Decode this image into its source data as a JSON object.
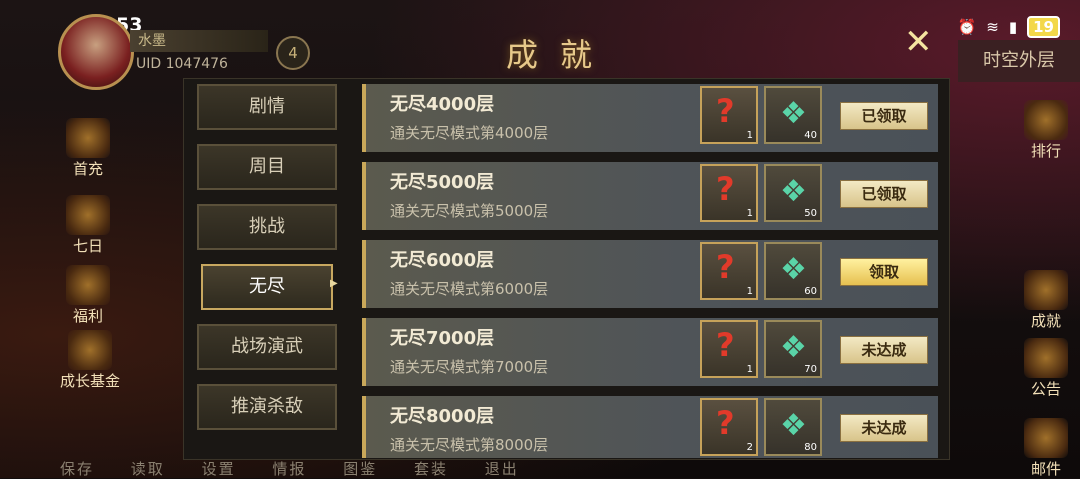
{
  "status_bar": {
    "time": "21:53",
    "battery": "19"
  },
  "player": {
    "name": "水墨",
    "uid": "UID 1047476",
    "level": "4"
  },
  "window": {
    "title": "成就",
    "right_label": "时空外层"
  },
  "tabs": [
    {
      "label": "剧情"
    },
    {
      "label": "周目"
    },
    {
      "label": "挑战"
    },
    {
      "label": "无尽"
    },
    {
      "label": "战场演武"
    },
    {
      "label": "推演杀敌"
    }
  ],
  "achievements": [
    {
      "title": "无尽4000层",
      "desc": "通关无尽模式第4000层",
      "chest_count": "1",
      "gem_count": "40",
      "status": "已领取"
    },
    {
      "title": "无尽5000层",
      "desc": "通关无尽模式第5000层",
      "chest_count": "1",
      "gem_count": "50",
      "status": "已领取"
    },
    {
      "title": "无尽6000层",
      "desc": "通关无尽模式第6000层",
      "chest_count": "1",
      "gem_count": "60",
      "status": "领取"
    },
    {
      "title": "无尽7000层",
      "desc": "通关无尽模式第7000层",
      "chest_count": "1",
      "gem_count": "70",
      "status": "未达成"
    },
    {
      "title": "无尽8000层",
      "desc": "通关无尽模式第8000层",
      "chest_count": "2",
      "gem_count": "80",
      "status": "未达成"
    }
  ],
  "left_menu": [
    {
      "label": "首充"
    },
    {
      "label": "七日"
    },
    {
      "label": "福利"
    },
    {
      "label": "成长基金"
    }
  ],
  "right_menu": [
    {
      "label": "排行"
    },
    {
      "label": "成就"
    },
    {
      "label": "公告"
    },
    {
      "label": "邮件"
    }
  ],
  "bottom_menu": [
    "保存",
    "读取",
    "设置",
    "情报",
    "图鉴",
    "套装",
    "退出"
  ],
  "icons": {
    "chest": "mystery-chest-icon",
    "gem": "jade-gem-icon",
    "close": "close-icon"
  }
}
